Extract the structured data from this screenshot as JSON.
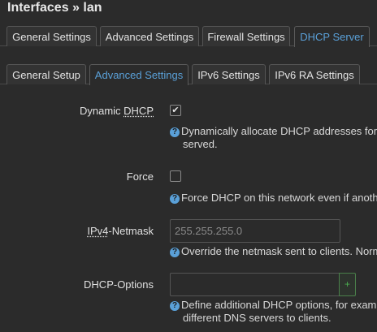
{
  "title": {
    "prefix": "Interfaces",
    "separator": " » ",
    "name": "lan"
  },
  "main_tabs": [
    {
      "label": "General Settings",
      "active": false
    },
    {
      "label": "Advanced Settings",
      "active": false
    },
    {
      "label": "Firewall Settings",
      "active": false
    },
    {
      "label": "DHCP Server",
      "active": true
    }
  ],
  "sub_tabs": [
    {
      "label": "General Setup",
      "active": false
    },
    {
      "label": "Advanced Settings",
      "active": true
    },
    {
      "label": "IPv6 Settings",
      "active": false
    },
    {
      "label": "IPv6 RA Settings",
      "active": false
    }
  ],
  "fields": {
    "dynamic_dhcp": {
      "label_plain": "Dynamic ",
      "label_abbr": "DHCP",
      "checked": true,
      "check_glyph": "✔",
      "help": [
        "Dynamically allocate DHCP addresses for",
        "served."
      ]
    },
    "force": {
      "label": "Force",
      "checked": false,
      "help": [
        "Force DHCP on this network even if anoth"
      ]
    },
    "ipv4_netmask": {
      "label_abbr": "IPv4",
      "label_rest": "-Netmask",
      "value": "",
      "placeholder": "255.255.255.0",
      "help": [
        "Override the netmask sent to clients. Norm"
      ]
    },
    "dhcp_options": {
      "label": "DHCP-Options",
      "value": "",
      "add_label": "+",
      "help": [
        "Define additional DHCP options, for exam",
        "different DNS servers to clients."
      ]
    }
  },
  "icons": {
    "help": "question-circle-icon",
    "help_glyph": "?"
  },
  "colors": {
    "background": "#2b2b2b",
    "accent": "#5aa0d8",
    "add_button": "#4caf50"
  }
}
